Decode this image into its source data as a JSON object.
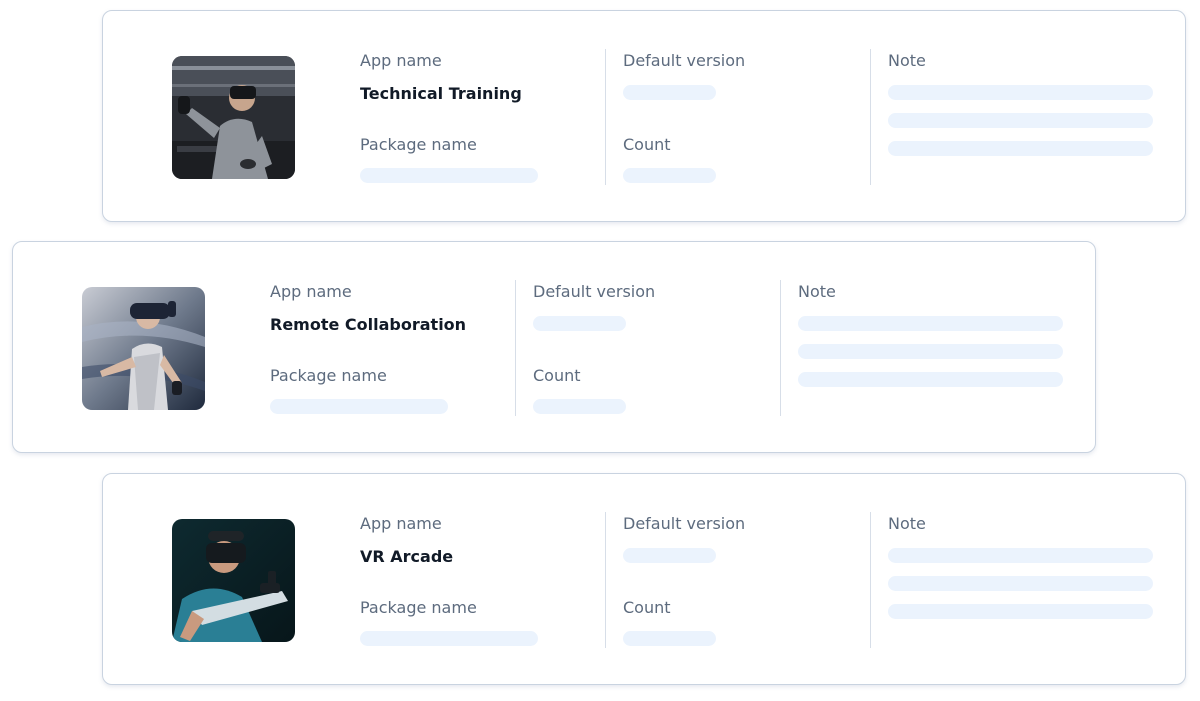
{
  "labels": {
    "app_name": "App name",
    "package_name": "Package name",
    "default_version": "Default version",
    "count": "Count",
    "note": "Note"
  },
  "apps": [
    {
      "name": "Technical Training"
    },
    {
      "name": "Remote Collaboration"
    },
    {
      "name": "VR Arcade"
    }
  ],
  "colors": {
    "skeleton": "#ebf3fd",
    "card_border": "#c9d3e0",
    "label_text": "#5d6b7e",
    "value_text": "#111a27"
  }
}
